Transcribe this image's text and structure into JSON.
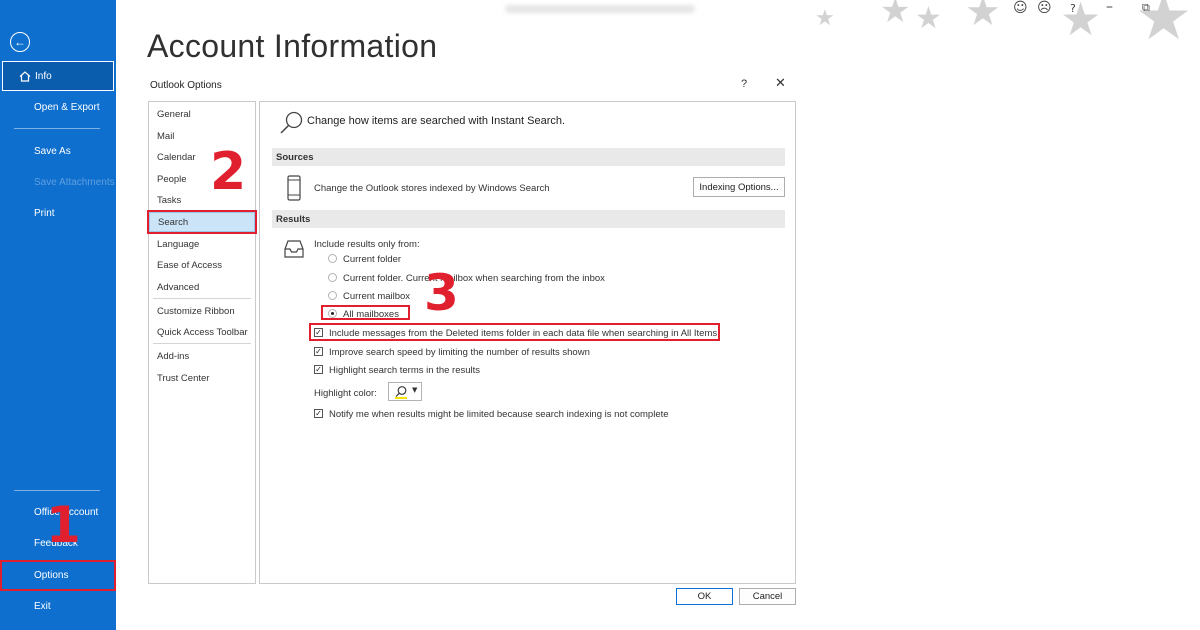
{
  "page_title": "Account Information",
  "sidebar": {
    "back_icon": "arrow-left-circle-icon",
    "items": [
      {
        "label": "Info",
        "icon": "home-icon"
      },
      {
        "label": "Open & Export"
      },
      {
        "label": "Save As"
      },
      {
        "label": "Save Attachments"
      },
      {
        "label": "Print"
      },
      {
        "label": "Office Account"
      },
      {
        "label": "Feedback"
      },
      {
        "label": "Options"
      },
      {
        "label": "Exit"
      }
    ]
  },
  "window_controls": {
    "smiley": "☺",
    "frown": "☹",
    "help": "?",
    "minimize": "–",
    "restore": "⧉"
  },
  "dialog": {
    "title": "Outlook Options",
    "help": "?",
    "close": "✕",
    "categories": [
      "General",
      "Mail",
      "Calendar",
      "People",
      "Tasks",
      "Search",
      "Language",
      "Ease of Access",
      "Advanced",
      "Customize Ribbon",
      "Quick Access Toolbar",
      "Add-ins",
      "Trust Center"
    ],
    "header": "Change how items are searched with Instant Search.",
    "sources": {
      "title": "Sources",
      "description": "Change the Outlook stores indexed by Windows Search",
      "button": "Indexing Options..."
    },
    "results": {
      "title": "Results",
      "include_label": "Include results only from:",
      "radios": [
        {
          "label": "Current folder",
          "checked": false
        },
        {
          "label": "Current folder. Current mailbox when searching from the inbox",
          "checked": false
        },
        {
          "label": "Current mailbox",
          "checked": false
        },
        {
          "label": "All mailboxes",
          "checked": true
        }
      ],
      "checkboxes": [
        {
          "label": "Include messages from the Deleted items folder in each data file when searching in All Items",
          "checked": true
        },
        {
          "label": "Improve search speed by limiting the number of results shown",
          "checked": true
        },
        {
          "label": "Highlight search terms in the results",
          "checked": true
        }
      ],
      "highlight_label": "Highlight color:",
      "notify_checkbox": {
        "label": "Notify me when results might be limited because search indexing is not complete",
        "checked": true
      }
    },
    "ok": "OK",
    "cancel": "Cancel"
  },
  "steps": [
    "1",
    "2",
    "3"
  ],
  "colors": {
    "accent": "#0e6fce",
    "annotation": "#e0202e"
  }
}
